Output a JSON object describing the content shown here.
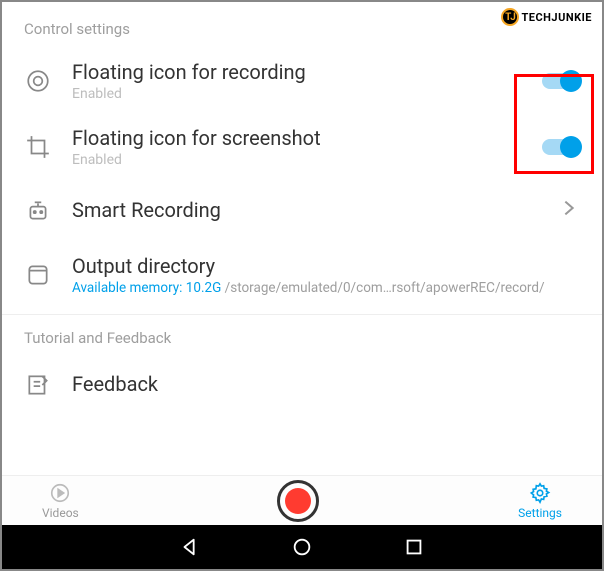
{
  "watermark": {
    "icon_text": "TJ",
    "text": "TECHJUNKIE"
  },
  "sections": {
    "control": "Control settings",
    "tutorial": "Tutorial and Feedback"
  },
  "items": {
    "floating_record": {
      "title": "Floating icon for recording",
      "sub": "Enabled",
      "toggle": true
    },
    "floating_screenshot": {
      "title": "Floating icon for screenshot",
      "sub": "Enabled",
      "toggle": true
    },
    "smart_recording": {
      "title": "Smart Recording"
    },
    "output": {
      "title": "Output directory",
      "mem_label": "Available memory: ",
      "mem_val": "10.2G",
      "path": "  /storage/emulated/0/com…rsoft/apowerREC/record/"
    },
    "feedback": {
      "title": "Feedback"
    }
  },
  "tabs": {
    "videos": "Videos",
    "settings": "Settings"
  }
}
